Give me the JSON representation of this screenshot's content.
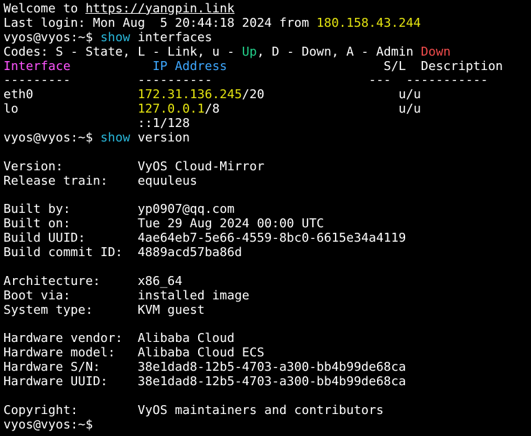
{
  "colors": {
    "background": "#000000",
    "foreground": "#ffffff",
    "yellow": "#e5e510",
    "magenta": "#ff55ff",
    "blue": "#3ea8ff",
    "cyan": "#29b8db",
    "green": "#23d18b",
    "red": "#f14c4c"
  },
  "welcome": {
    "prefix": "Welcome to ",
    "url": "https://yangpin.link"
  },
  "last_login": {
    "prefix": "Last login: Mon Aug  5 20:44:18 2024 from ",
    "ip": "180.158.43.244"
  },
  "prompt": "vyos@vyos:~$ ",
  "cmd_interfaces": {
    "keyword": "show",
    "arg": " interfaces"
  },
  "codes": {
    "text1": "Codes: S - State, L - Link, u - ",
    "up": "Up",
    "text2": ", D - Down, A - Admin ",
    "down": "Down"
  },
  "interfaces_table": {
    "headers": {
      "interface": "Interface",
      "pad1": "           ",
      "ip": "IP Address",
      "pad2": "                     ",
      "sl": "S/L",
      "pad3": "  ",
      "description": "Description"
    },
    "underline": "---------         ----------                     ---  -----------",
    "rows": [
      {
        "name": "eth0",
        "pad": "              ",
        "ip": "172.31.136.245",
        "mask": "/20",
        "pad2": "                  ",
        "sl": "u/u"
      },
      {
        "name": "lo",
        "pad": "                ",
        "ip": "127.0.0.1",
        "mask": "/8",
        "pad2": "                        ",
        "sl": "u/u"
      }
    ],
    "ipv6_line": "                  ::1/128"
  },
  "cmd_version": {
    "keyword": "show",
    "arg": " version"
  },
  "version_info": [
    {
      "text": ""
    },
    {
      "text": "Version:          VyOS Cloud-Mirror"
    },
    {
      "text": "Release train:    equuleus"
    },
    {
      "text": ""
    },
    {
      "text": "Built by:         yp0907@qq.com"
    },
    {
      "text": "Built on:         Tue 29 Aug 2024 00:00 UTC"
    },
    {
      "text": "Build UUID:       4ae64eb7-5e66-4559-8bc0-6615e34a4119"
    },
    {
      "text": "Build commit ID:  4889acd57ba86d"
    },
    {
      "text": ""
    },
    {
      "text": "Architecture:     x86_64"
    },
    {
      "text": "Boot via:         installed image"
    },
    {
      "text": "System type:      KVM guest"
    },
    {
      "text": ""
    },
    {
      "text": "Hardware vendor:  Alibaba Cloud"
    },
    {
      "text": "Hardware model:   Alibaba Cloud ECS"
    },
    {
      "text": "Hardware S/N:     38e1dad8-12b5-4703-a300-bb4b99de68ca"
    },
    {
      "text": "Hardware UUID:    38e1dad8-12b5-4703-a300-bb4b99de68ca"
    },
    {
      "text": ""
    },
    {
      "text": "Copyright:        VyOS maintainers and contributors"
    }
  ]
}
